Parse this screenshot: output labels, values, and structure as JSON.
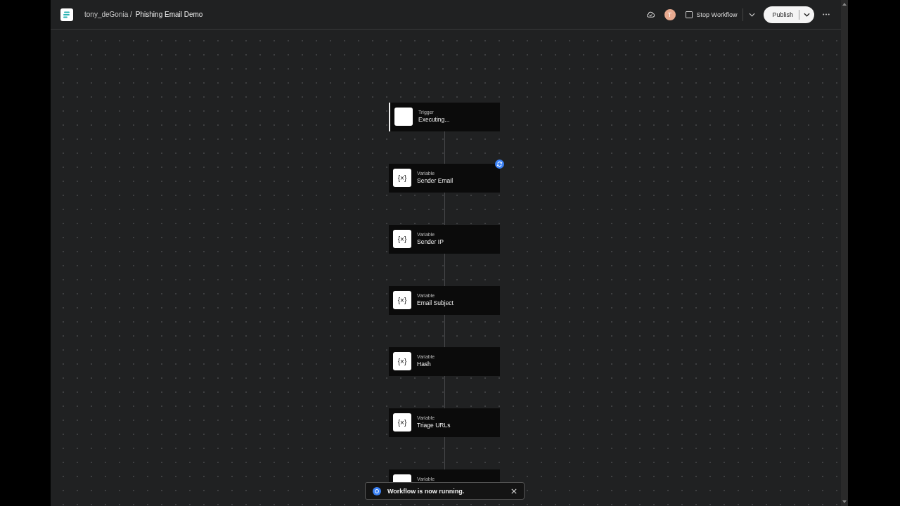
{
  "header": {
    "workspace": "tony_deGonia /",
    "title": "Phishing Email Demo",
    "avatar": "T",
    "stop_workflow": {
      "label": "Stop Workflow",
      "checked": false
    },
    "publish": "Publish"
  },
  "nodes": [
    {
      "kind": "trigger",
      "type": "Trigger",
      "title": "Executing...",
      "syncing": false
    },
    {
      "kind": "variable",
      "icon": "{×}",
      "type": "Variable",
      "title": "Sender Email",
      "syncing": true
    },
    {
      "kind": "variable",
      "icon": "{×}",
      "type": "Variable",
      "title": "Sender IP",
      "syncing": false
    },
    {
      "kind": "variable",
      "icon": "{×}",
      "type": "Variable",
      "title": "Email Subject",
      "syncing": false
    },
    {
      "kind": "variable",
      "icon": "{×}",
      "type": "Variable",
      "title": "Hash",
      "syncing": false
    },
    {
      "kind": "variable",
      "icon": "{×}",
      "type": "Variable",
      "title": "Triage URLs",
      "syncing": false
    },
    {
      "kind": "variable",
      "type": "Variable",
      "syncing": false
    }
  ],
  "toast": {
    "message": "Workflow is now running."
  }
}
